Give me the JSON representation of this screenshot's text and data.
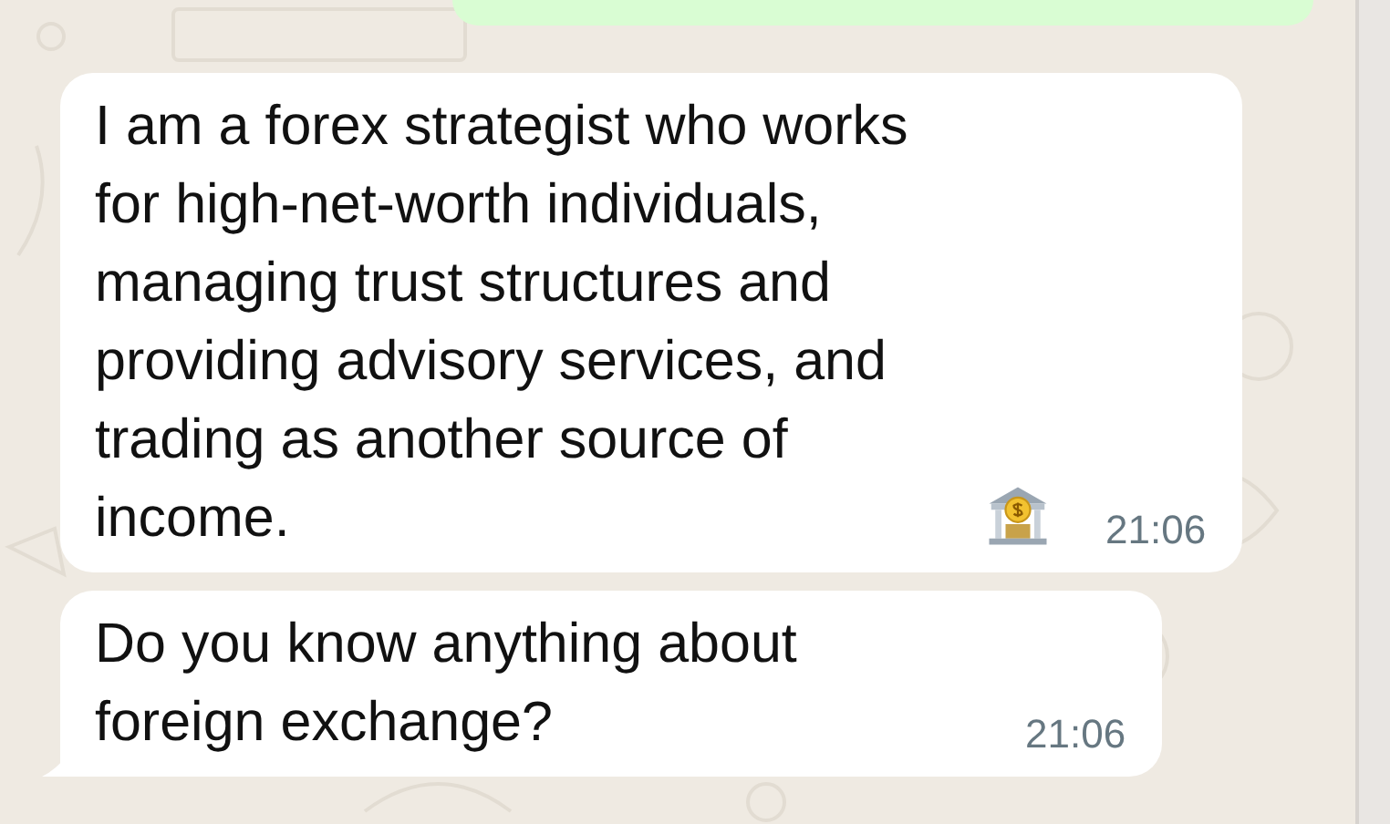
{
  "messages": [
    {
      "text": "I am a forex strategist who works for high-net-worth individuals, managing trust structures and providing advisory services, and trading as another source of income.",
      "time": "21:06",
      "kind": "text_with_icon",
      "tail": false
    },
    {
      "text": "Do you know anything about foreign exchange?",
      "time": "21:06",
      "kind": "text",
      "tail": true
    }
  ]
}
